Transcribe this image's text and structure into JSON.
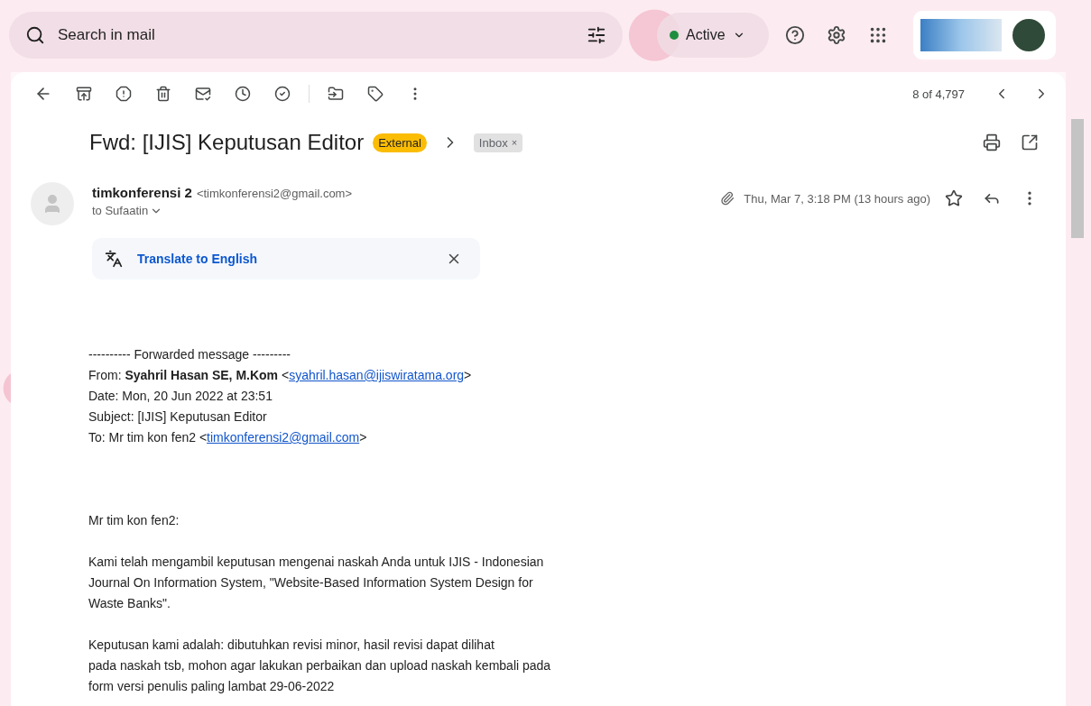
{
  "search": {
    "placeholder": "Search in mail"
  },
  "status": {
    "label": "Active",
    "on": true
  },
  "toolbar": {
    "pager": "8 of 4,797"
  },
  "message": {
    "subject": "Fwd: [IJIS] Keputusan Editor",
    "labels": [
      {
        "text": "External",
        "kind": "warning"
      },
      {
        "text": "Inbox",
        "kind": "removable",
        "remove": "×"
      }
    ],
    "sender_name": "timkonferensi 2",
    "sender_email": "<timkonferensi2@gmail.com>",
    "recipient": "to Sufaatin",
    "date": "Thu, Mar 7, 3:18 PM (13 hours ago)",
    "starred": false,
    "translate": "Translate to English",
    "forward_header": "---------- Forwarded message ---------",
    "header_lines": [
      {
        "prefix": "From: **Syahril Hasan SE, M.Kom** <",
        "link": "syahril.hasan@ijiswiratama.org",
        "suffix": ">"
      },
      {
        "prefix": "Date: Mon, 20 Jun 2022 at 23:51"
      },
      {
        "prefix": "Subject: [IJIS] Keputusan Editor"
      },
      {
        "prefix": "To: Mr tim kon fen2 <",
        "link": "timkonferensi2@gmail.com",
        "suffix": ">"
      }
    ],
    "paragraphs": [
      {
        "lines": [
          "Mr tim kon fen2:"
        ]
      },
      {
        "lines": [
          "Kami telah mengambil keputusan mengenai naskah Anda untuk IJIS - Indonesian",
          "Journal On Information System, \"Website-Based Information System Design for",
          "Waste Banks\"."
        ]
      },
      {
        "lines": [
          "Keputusan kami adalah: dibutuhkan revisi minor, hasil revisi dapat dilihat",
          "pada naskah tsb, mohon agar lakukan perbaikan dan upload naskah kembali pada",
          "form versi penulis paling lambat 29-06-2022"
        ]
      }
    ]
  }
}
